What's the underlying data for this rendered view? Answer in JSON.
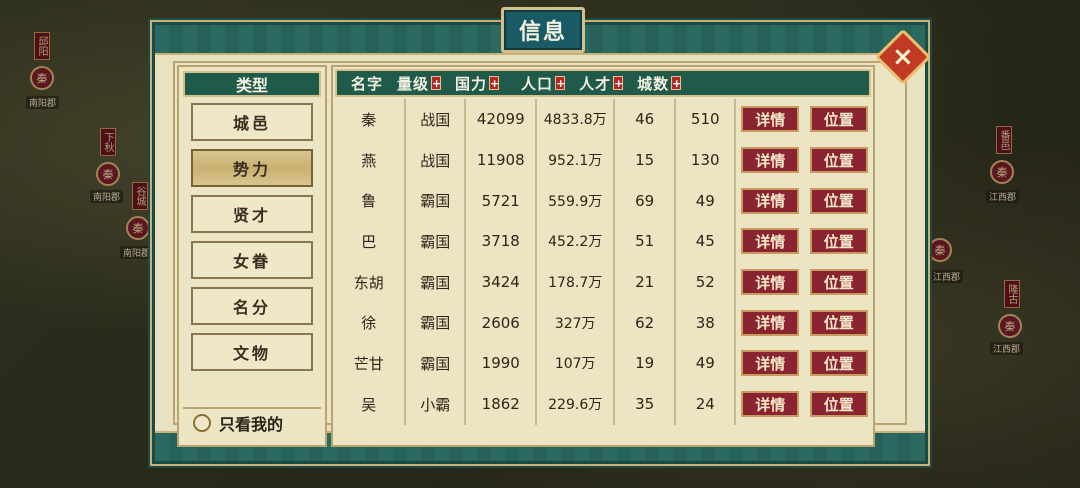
{
  "dialog": {
    "title": "信息",
    "close_icon": "×"
  },
  "map": {
    "labels": [
      "南阳郡",
      "南阳郡",
      "南阳郡",
      "江西郡",
      "江西郡",
      "江西郡"
    ],
    "seals": [
      "秦",
      "秦",
      "秦",
      "秦",
      "秦",
      "秦"
    ],
    "banners": [
      "邱阳",
      "下秋",
      "谷城",
      "番邑",
      "隆古"
    ]
  },
  "left_panel": {
    "header": "类型",
    "categories": [
      "城邑",
      "势力",
      "贤才",
      "女眷",
      "名分",
      "文物"
    ],
    "active_index": 1,
    "only_mine_label": "只看我的"
  },
  "table": {
    "columns": [
      {
        "label": "名字",
        "sortable": false
      },
      {
        "label": "量级",
        "sortable": true
      },
      {
        "label": "国力",
        "sortable": true
      },
      {
        "label": "人口",
        "sortable": true
      },
      {
        "label": "人才",
        "sortable": true
      },
      {
        "label": "城数",
        "sortable": true
      }
    ],
    "sort_glyph": "+",
    "detail_label": "详情",
    "position_label": "位置",
    "rows": [
      {
        "name": "秦",
        "rank": "战国",
        "power": "42099",
        "population": "4833.8万",
        "talent": "46",
        "cities": "510"
      },
      {
        "name": "燕",
        "rank": "战国",
        "power": "11908",
        "population": "952.1万",
        "talent": "15",
        "cities": "130"
      },
      {
        "name": "鲁",
        "rank": "霸国",
        "power": "5721",
        "population": "559.9万",
        "talent": "69",
        "cities": "49"
      },
      {
        "name": "巴",
        "rank": "霸国",
        "power": "3718",
        "population": "452.2万",
        "talent": "51",
        "cities": "45"
      },
      {
        "name": "东胡",
        "rank": "霸国",
        "power": "3424",
        "population": "178.7万",
        "talent": "21",
        "cities": "52"
      },
      {
        "name": "徐",
        "rank": "霸国",
        "power": "2606",
        "population": "327万",
        "talent": "62",
        "cities": "38"
      },
      {
        "name": "芒甘",
        "rank": "霸国",
        "power": "1990",
        "population": "107万",
        "talent": "19",
        "cities": "49"
      },
      {
        "name": "吴",
        "rank": "小霸",
        "power": "1862",
        "population": "229.6万",
        "talent": "35",
        "cities": "24"
      }
    ]
  }
}
